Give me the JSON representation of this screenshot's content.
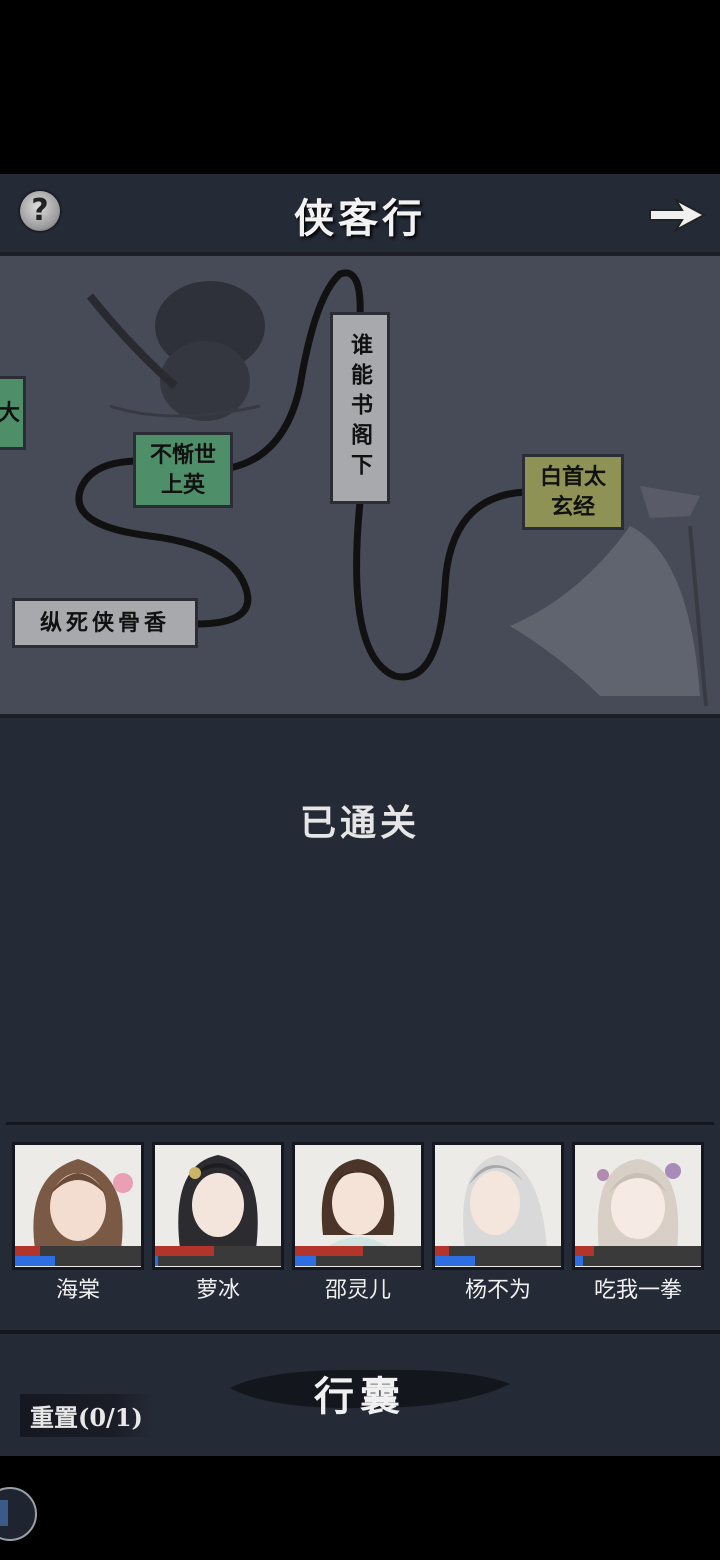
{
  "header": {
    "help_label": "?",
    "title": "侠客行"
  },
  "map": {
    "nodes": [
      {
        "label": "大"
      },
      {
        "label": "不惭世上英"
      },
      {
        "label": "谁能书阁下"
      },
      {
        "label": "白首太玄经"
      },
      {
        "label": "纵死侠骨香"
      }
    ]
  },
  "status": "已通关",
  "party": [
    {
      "name": "海棠",
      "hp": 0.2,
      "mp": 0.32
    },
    {
      "name": "萝冰",
      "hp": 0.47,
      "mp": 0.02
    },
    {
      "name": "邵灵儿",
      "hp": 0.54,
      "mp": 0.17
    },
    {
      "name": "杨不为",
      "hp": 0.11,
      "mp": 0.32
    },
    {
      "name": "吃我一拳",
      "hp": 0.15,
      "mp": 0.06
    }
  ],
  "footer": {
    "bag_label": "行囊",
    "reset_label": "重置(0/1)"
  },
  "colors": {
    "background": "#252a37",
    "map": "#474b58",
    "node_green": "#4e8f69",
    "node_gray": "#a7a9ad",
    "node_olive": "#8f9255",
    "hp": "#b2342a",
    "mp": "#2d6fe0"
  }
}
